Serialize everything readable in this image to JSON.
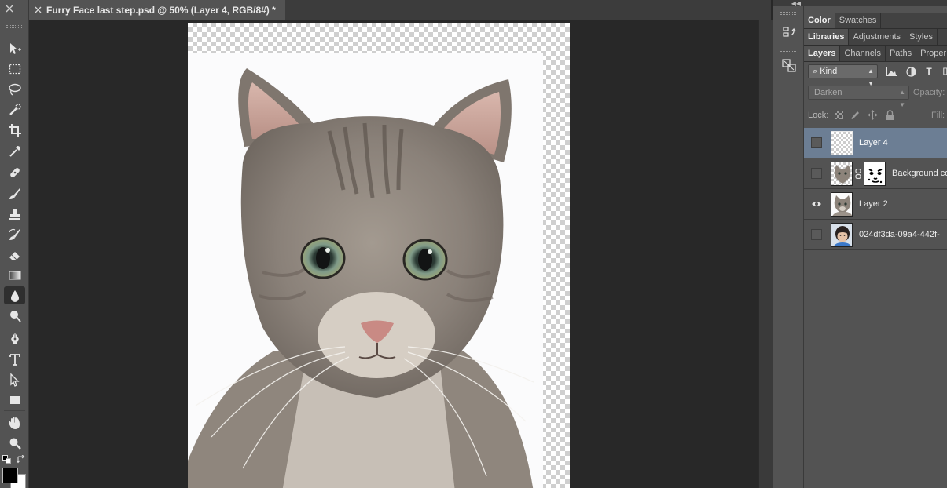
{
  "document": {
    "tab_title": "Furry Face last step.psd @ 50% (Layer 4, RGB/8#) *"
  },
  "tools": [
    {
      "name": "move-tool",
      "icon": "move-icon"
    },
    {
      "name": "marquee-tool",
      "icon": "rectangular-marquee-icon"
    },
    {
      "name": "lasso-tool",
      "icon": "lasso-icon"
    },
    {
      "name": "quick-selection-tool",
      "icon": "quick-selection-icon"
    },
    {
      "name": "crop-tool",
      "icon": "crop-icon"
    },
    {
      "name": "eyedropper-tool",
      "icon": "eyedropper-icon"
    },
    {
      "name": "healing-brush-tool",
      "icon": "healing-brush-icon"
    },
    {
      "name": "brush-tool",
      "icon": "brush-icon"
    },
    {
      "name": "clone-stamp-tool",
      "icon": "clone-stamp-icon"
    },
    {
      "name": "history-brush-tool",
      "icon": "history-brush-icon"
    },
    {
      "name": "eraser-tool",
      "icon": "eraser-icon"
    },
    {
      "name": "gradient-tool",
      "icon": "gradient-icon"
    },
    {
      "name": "blur-tool",
      "icon": "blur-drop-icon",
      "active": true
    },
    {
      "name": "dodge-tool",
      "icon": "dodge-icon"
    },
    {
      "name": "pen-tool",
      "icon": "pen-icon"
    },
    {
      "name": "type-tool",
      "icon": "type-icon"
    },
    {
      "name": "path-selection-tool",
      "icon": "path-selection-icon"
    },
    {
      "name": "rectangle-tool",
      "icon": "rectangle-icon"
    },
    {
      "name": "hand-tool",
      "icon": "hand-icon"
    },
    {
      "name": "zoom-tool",
      "icon": "zoom-icon"
    }
  ],
  "colors": {
    "foreground": "#000000",
    "background": "#ffffff",
    "selected_layer": "#6c7e94",
    "panel": "#535353"
  },
  "panels": {
    "row1_tabs": [
      "Color",
      "Swatches"
    ],
    "row2_tabs": [
      "Libraries",
      "Adjustments",
      "Styles"
    ],
    "row3_tabs": [
      "Layers",
      "Channels",
      "Paths",
      "Proper"
    ],
    "filter_kind": "Kind",
    "blend_mode": "Darken",
    "opacity_label": "Opacity:",
    "lock_label": "Lock:",
    "fill_label": "Fill:"
  },
  "layers": [
    {
      "name": "Layer 4",
      "visible": false,
      "selected": true,
      "thumb": "transparent"
    },
    {
      "name": "Background co",
      "visible": false,
      "selected": false,
      "thumb": "cat-with-mask"
    },
    {
      "name": "Layer 2",
      "visible": true,
      "selected": false,
      "thumb": "cat"
    },
    {
      "name": "024df3da-09a4-442f-",
      "visible": false,
      "selected": false,
      "thumb": "boy"
    }
  ]
}
